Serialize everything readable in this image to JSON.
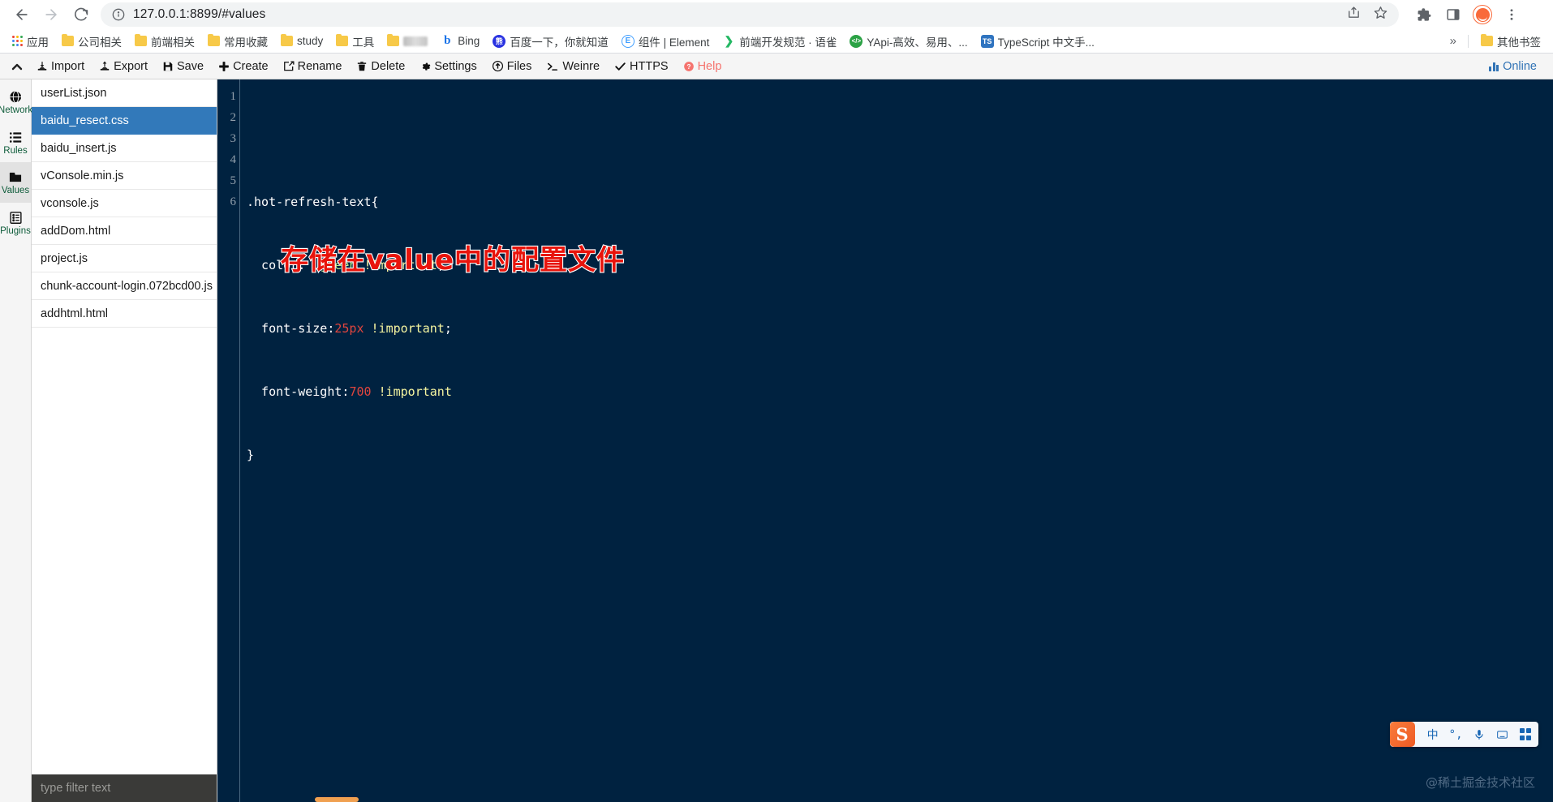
{
  "browser": {
    "url": "127.0.0.1:8899/#values",
    "back_title": "Back",
    "forward_title": "Forward",
    "reload_title": "Reload",
    "site_info_title": "View site information",
    "share_title": "Share this page",
    "bookmark_title": "Bookmark this tab",
    "extensions_title": "Extensions",
    "sidepanel_title": "Side panel",
    "profile_title": "Profile",
    "menu_title": "Customize and control Chrome"
  },
  "bookmarks": {
    "apps_label": "应用",
    "items": [
      {
        "label": "公司相关",
        "icon": "folder-icon",
        "type": "folder"
      },
      {
        "label": "前端相关",
        "icon": "folder-icon",
        "type": "folder"
      },
      {
        "label": "常用收藏",
        "icon": "folder-icon",
        "type": "folder"
      },
      {
        "label": "study",
        "icon": "folder-icon",
        "type": "folder"
      },
      {
        "label": "工具",
        "icon": "folder-icon",
        "type": "folder"
      },
      {
        "label": "",
        "icon": "folder-icon",
        "type": "folder-blurred"
      },
      {
        "label": "Bing",
        "icon": "bing-icon",
        "type": "link"
      },
      {
        "label": "百度一下，你就知道",
        "icon": "baidu-icon",
        "type": "link"
      },
      {
        "label": "组件 | Element",
        "icon": "element-icon",
        "type": "link"
      },
      {
        "label": "前端开发规范 · 语雀",
        "icon": "yuque-icon",
        "type": "link"
      },
      {
        "label": "YApi-高效、易用、...",
        "icon": "yapi-icon",
        "type": "link"
      },
      {
        "label": "TypeScript 中文手...",
        "icon": "typescript-icon",
        "type": "link"
      }
    ],
    "overflow_label": "»",
    "other_bookmarks_label": "其他书签"
  },
  "toolbar": {
    "collapse_label": "▲",
    "buttons": [
      {
        "label": "Import",
        "icon": "import-icon"
      },
      {
        "label": "Export",
        "icon": "export-icon"
      },
      {
        "label": "Save",
        "icon": "save-icon"
      },
      {
        "label": "Create",
        "icon": "plus-icon"
      },
      {
        "label": "Rename",
        "icon": "rename-icon"
      },
      {
        "label": "Delete",
        "icon": "trash-icon"
      },
      {
        "label": "Settings",
        "icon": "gear-icon"
      },
      {
        "label": "Files",
        "icon": "files-icon"
      },
      {
        "label": "Weinre",
        "icon": "terminal-icon"
      },
      {
        "label": "HTTPS",
        "icon": "check-icon"
      },
      {
        "label": "Help",
        "icon": "help-icon"
      }
    ],
    "status": {
      "label": "Online",
      "icon": "bars-icon",
      "color": "#3173b5"
    }
  },
  "rail": {
    "items": [
      {
        "label": "Network",
        "icon": "globe-icon",
        "active": false
      },
      {
        "label": "Rules",
        "icon": "list-icon",
        "active": false
      },
      {
        "label": "Values",
        "icon": "folder-solid-icon",
        "active": true
      },
      {
        "label": "Plugins",
        "icon": "plugins-icon",
        "active": false
      }
    ]
  },
  "files": {
    "items": [
      {
        "name": "userList.json",
        "selected": false
      },
      {
        "name": "baidu_resect.css",
        "selected": true
      },
      {
        "name": "baidu_insert.js",
        "selected": false
      },
      {
        "name": "vConsole.min.js",
        "selected": false
      },
      {
        "name": "vconsole.js",
        "selected": false
      },
      {
        "name": "addDom.html",
        "selected": false
      },
      {
        "name": "project.js",
        "selected": false
      },
      {
        "name": "chunk-account-login.072bcd00.js",
        "selected": false
      },
      {
        "name": "addhtml.html",
        "selected": false
      }
    ],
    "filter_placeholder": "type filter text",
    "filter_value": "",
    "selected_color": "#3279ba"
  },
  "editor": {
    "line_numbers": [
      "1",
      "2",
      "3",
      "4",
      "5",
      "6"
    ],
    "lines": [
      {
        "n": "1",
        "tokens": []
      },
      {
        "n": "2",
        "tokens": [
          {
            "t": ".hot-refresh-text{",
            "c": "tok-sel"
          }
        ]
      },
      {
        "n": "3",
        "tokens": [
          {
            "t": "  color:  ",
            "c": "tok-prop"
          },
          {
            "t": "green",
            "c": "tok-val-green"
          },
          {
            "t": " ",
            "c": "tok-prop"
          },
          {
            "t": "!important",
            "c": "tok-imp"
          },
          {
            "t": ";",
            "c": "tok-punc"
          }
        ]
      },
      {
        "n": "4",
        "tokens": [
          {
            "t": "  font-size:",
            "c": "tok-prop"
          },
          {
            "t": "25px",
            "c": "tok-num"
          },
          {
            "t": " ",
            "c": "tok-prop"
          },
          {
            "t": "!important",
            "c": "tok-imp"
          },
          {
            "t": ";",
            "c": "tok-punc"
          }
        ]
      },
      {
        "n": "5",
        "tokens": [
          {
            "t": "  font-weight:",
            "c": "tok-prop"
          },
          {
            "t": "700",
            "c": "tok-num"
          },
          {
            "t": " ",
            "c": "tok-prop"
          },
          {
            "t": "!important",
            "c": "tok-imp"
          }
        ]
      },
      {
        "n": "6",
        "tokens": [
          {
            "t": "}",
            "c": "tok-punc"
          }
        ]
      }
    ],
    "plain_text": ".hot-refresh-text{\n  color:  green !important;\n  font-size:25px !important;\n  font-weight:700 !important\n}",
    "background": "#002240",
    "annotation": "存储在value中的配置文件",
    "annotation_color": "#e8140c"
  },
  "ime": {
    "logo_label": "S",
    "items": [
      {
        "label": "中",
        "icon": "chinese-mode-icon"
      },
      {
        "label": "°,",
        "icon": "punctuation-icon"
      },
      {
        "label": "",
        "icon": "microphone-icon"
      },
      {
        "label": "",
        "icon": "keyboard-icon"
      },
      {
        "label": "",
        "icon": "apps-grid-icon"
      }
    ]
  },
  "watermark": {
    "text": "@稀土掘金技术社区"
  }
}
